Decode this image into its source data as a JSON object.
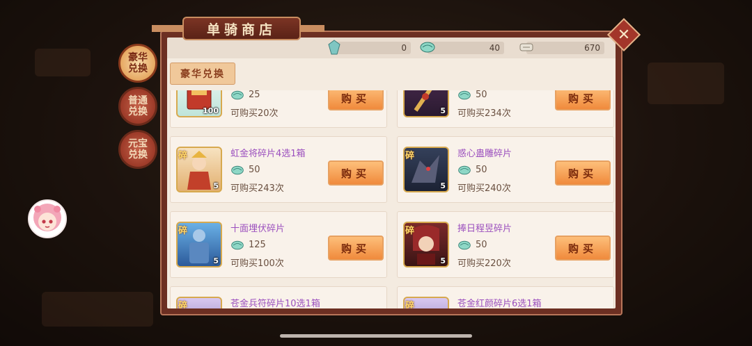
{
  "shop": {
    "title": "单骑商店"
  },
  "side_tabs": [
    {
      "label": "豪华兑换",
      "active": true
    },
    {
      "label": "普通兑换",
      "active": false
    },
    {
      "label": "元宝兑换",
      "active": false
    }
  ],
  "currencies": [
    {
      "icon": "crystal-icon",
      "value": "0"
    },
    {
      "icon": "token-icon",
      "value": "40"
    },
    {
      "icon": "scroll-icon",
      "value": "670"
    }
  ],
  "sub_tab": {
    "label": "豪华兑换"
  },
  "buy_label": "购买",
  "items": [
    {
      "name": "",
      "price": "25",
      "limit": "可购买20次",
      "qty": "100",
      "badge": "",
      "art": "book"
    },
    {
      "name": "",
      "price": "50",
      "limit": "可购买234次",
      "qty": "5",
      "badge": "",
      "art": "spear"
    },
    {
      "name": "虹金将碎片4选1箱",
      "price": "50",
      "limit": "可购买243次",
      "qty": "5",
      "badge": "碎",
      "art": "warrior"
    },
    {
      "name": "惑心蛊雕碎片",
      "price": "50",
      "limit": "可购买240次",
      "qty": "5",
      "badge": "碎",
      "art": "beast"
    },
    {
      "name": "十面埋伏碎片",
      "price": "125",
      "limit": "可购买100次",
      "qty": "5",
      "badge": "碎",
      "art": "armor"
    },
    {
      "name": "捧日程昱碎片",
      "price": "50",
      "limit": "可购买220次",
      "qty": "5",
      "badge": "碎",
      "art": "hero"
    },
    {
      "name": "苍金兵符碎片10选1箱",
      "price": "",
      "limit": "",
      "qty": "",
      "badge": "碎",
      "art": "box"
    },
    {
      "name": "苍金红颜碎片6选1箱",
      "price": "",
      "limit": "",
      "qty": "",
      "badge": "碎",
      "art": "box"
    }
  ],
  "colors": {
    "accent": "#f08a3c",
    "panel": "#6c2f22",
    "name_text": "#9b4fbe"
  }
}
